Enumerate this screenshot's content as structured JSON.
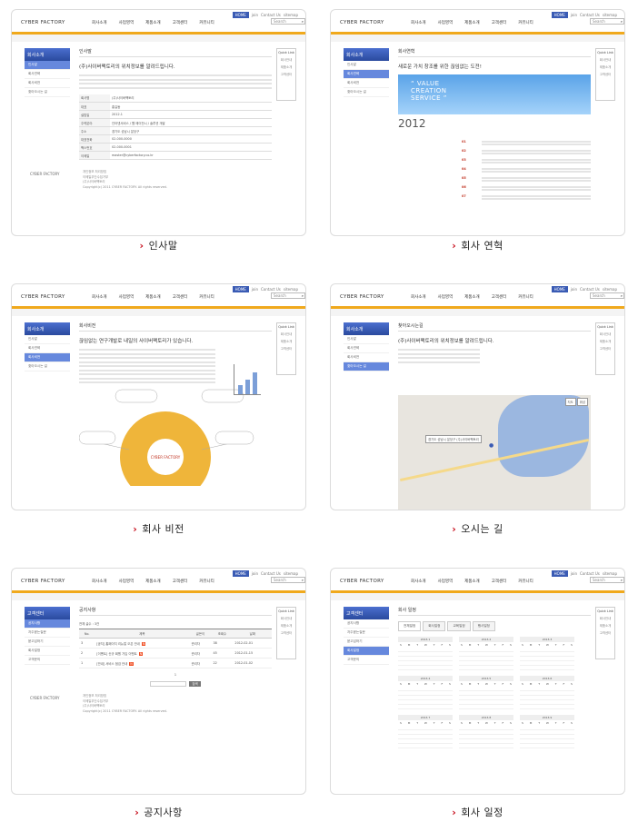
{
  "site": {
    "logo": "CYBER FACTORY",
    "home": "HOME",
    "join": "join",
    "contact": "Contact Us",
    "sitemap": "sitemap",
    "menu": [
      "회사소개",
      "사업영역",
      "제품소개",
      "고객센터",
      "커뮤니티"
    ],
    "search_placeholder": "Search",
    "footer_logo": "CYBER FACTORY",
    "footer_lines": [
      "개인정보 처리방침",
      "이메일무단수집거부",
      "(주)사이버팩토리",
      "Copyright(c) 2011 CYBER FACTORY. All rights reserved."
    ]
  },
  "captions": [
    "인사말",
    "회사 연혁",
    "회사 비전",
    "오시는 길",
    "공지사항",
    "회사 일정"
  ],
  "quick": {
    "title": "Quick Link",
    "items": [
      "회사안내",
      "제품소개",
      "고객센터"
    ]
  },
  "about_sub": {
    "title": "회사소개",
    "items": [
      "인사말",
      "회사연혁",
      "회사비전",
      "찾아오시는 길"
    ]
  },
  "cs_sub": {
    "title": "고객센터",
    "items": [
      "공지사항",
      "자주묻는질문",
      "묻고답하기",
      "회사일정",
      "고객문의"
    ]
  },
  "greeting": {
    "tab": "인사말",
    "headline": "(주)사이버팩토리의 위치정보를 알려드립니다.",
    "rows": [
      [
        "회사명",
        "(주)사이버팩토리"
      ],
      [
        "대표",
        "홍길동"
      ],
      [
        "설립일",
        "2012.1"
      ],
      [
        "주력분야",
        "인터넷서비스 / 웹 에이전시 / 솔루션 개발"
      ],
      [
        "주소",
        "경기도 성남시 분당구"
      ],
      [
        "대표전화",
        "02-000-0000"
      ],
      [
        "팩스번호",
        "02-000-0001"
      ],
      [
        "이메일",
        "master@cyberfactory.co.kr"
      ]
    ]
  },
  "history": {
    "tab": "회사연혁",
    "headline": "새로운 가치 창조를 위한 끊임없는 도전!",
    "banner": [
      "“ VALUE",
      "CREATION",
      "SERVICE ”"
    ],
    "year": "2012",
    "months": [
      "01",
      "02",
      "03",
      "04",
      "05",
      "06",
      "07"
    ]
  },
  "vision": {
    "tab": "회사비전",
    "headline": "끊임없는 연구개발로 내일의 사이버팩토리가 있습니다.",
    "center": "CYBER FACTORY"
  },
  "location": {
    "tab": "찾아오시는길",
    "headline": "(주)사이버팩토리의 위치정보를 알려드립니다.",
    "pin": "경기도 성남시 분당구 (주)사이버팩토리",
    "map_btns": [
      "지도",
      "위성"
    ]
  },
  "notice": {
    "tab": "공지사항",
    "total": "전체 글수 : 3건",
    "cols": [
      "No.",
      "제목",
      "글쓴이",
      "조회수",
      "날짜"
    ],
    "rows": [
      [
        "3",
        "[공지] 홈페이지 리뉴얼 오픈 안내",
        "관리자",
        "38",
        "2012-02-01"
      ],
      [
        "2",
        "[이벤트] 신규 회원 가입 이벤트",
        "관리자",
        "45",
        "2012-01-15"
      ],
      [
        "1",
        "[안내] 서비스 점검 안내",
        "관리자",
        "22",
        "2012-01-02"
      ]
    ],
    "search_btn": "검색",
    "pager": "1"
  },
  "schedule": {
    "tab": "회사 일정",
    "tabs": [
      "전체일정",
      "회사일정",
      "교육일정",
      "행사일정"
    ],
    "months": [
      "2013.1",
      "2013.2",
      "2013.3",
      "2013.4",
      "2013.5",
      "2013.6",
      "2013.7",
      "2013.8",
      "2013.9"
    ],
    "weekdays": [
      "S",
      "M",
      "T",
      "W",
      "T",
      "F",
      "S"
    ]
  }
}
